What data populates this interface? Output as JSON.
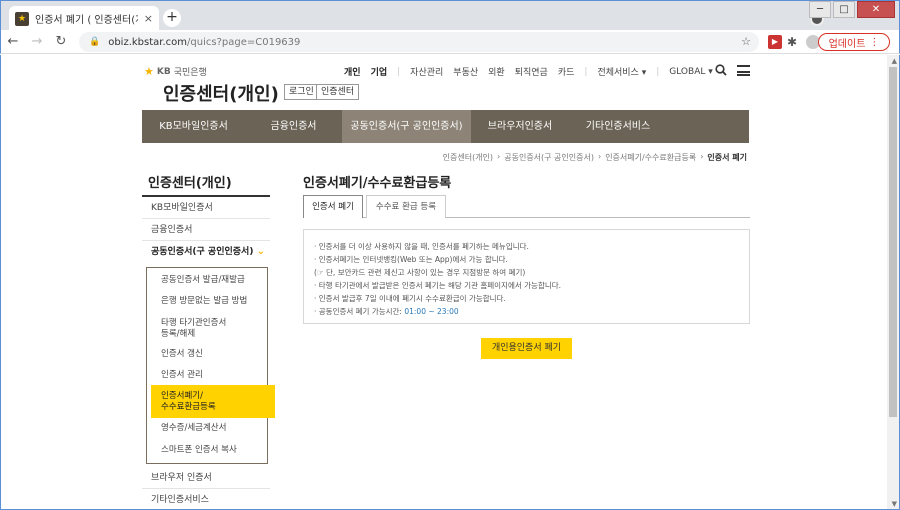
{
  "browser": {
    "tab_title": "인증서 폐기 ( 인증센터(개인) |",
    "tab_close": "×",
    "new_tab": "+",
    "url_host": "obiz.kbstar.com",
    "url_path": "/quics?page=C019639",
    "update_label": "업데이트",
    "update_more": "⋮",
    "win_min": "─",
    "win_max": "□",
    "win_close": "✕"
  },
  "site": {
    "logo_brand": "KB",
    "logo_text": "국민은행",
    "title": "인증센터(개인)",
    "login_button": "로그인",
    "cert_center_button": "인증센터",
    "topnav": {
      "personal": "개인",
      "business": "기업",
      "wealth": "자산관리",
      "realestate": "부동산",
      "fx": "외환",
      "pension": "퇴직연금",
      "card": "카드",
      "all_services": "전체서비스 ▾",
      "global": "GLOBAL ▾"
    }
  },
  "gnb": [
    {
      "label": "KB모바일인증서"
    },
    {
      "label": "금융인증서"
    },
    {
      "label": "공동인증서(구 공인인증서)"
    },
    {
      "label": "브라우저인증서"
    },
    {
      "label": "기타인증서비스"
    }
  ],
  "breadcrumb": {
    "home": "인증센터(개인)",
    "level1": "공동인증서(구 공인인증서)",
    "level2": "인증서폐기/수수료환급등록",
    "current": "인증서 폐기",
    "sep": "›"
  },
  "sidebar": {
    "title": "인증센터(개인)",
    "items": {
      "mobile": "KB모바일인증서",
      "financial": "금융인증서",
      "joint": "공동인증서(구 공인인증서)",
      "browser": "브라우저 인증서",
      "other": "기타인증서비스"
    },
    "chevron": "⌄",
    "sub": {
      "issue": "공동인증서 발급/재발급",
      "no_visit": "은행 방문없는 발급 방법",
      "other_inst_1": "타행 타기관인증서",
      "other_inst_2": "등록/해제",
      "renew": "인증서 갱신",
      "manage": "인증서 관리",
      "revoke_1": "인증서폐기/",
      "revoke_2": "수수료환급등록",
      "receipt": "영수증/세금계산서",
      "smartphone": "스마트폰 인증서 복사"
    }
  },
  "main": {
    "title": "인증서폐기/수수료환급등록",
    "tab_revoke": "인증서 폐기",
    "tab_refund": "수수료 환급 등록",
    "notice": {
      "line1": "· 인증서를 더 이상 사용하지 않을 때, 인증서를 폐기하는 메뉴입니다.",
      "line2": "· 인증서폐기는 인터넷뱅킹(Web 또는 App)에서 가능 합니다.",
      "line3": "  (☞ 단, 보안카드 관련 제신고 사항이 있는 경우 지점방문 하여 폐기)",
      "line4": "· 타행 타기관에서 발급받은 인증서 폐기는 해당 기관 홈페이지에서 가능합니다.",
      "line5": "· 인증서 발급후 7일 이내에 폐기시 수수료환급이 가능합니다.",
      "line6_prefix": "· 공동인증서 폐기 가능시간: ",
      "line6_hours": "01:00 ~ 23:00"
    },
    "primary_button": "개인용인증서 폐기"
  }
}
